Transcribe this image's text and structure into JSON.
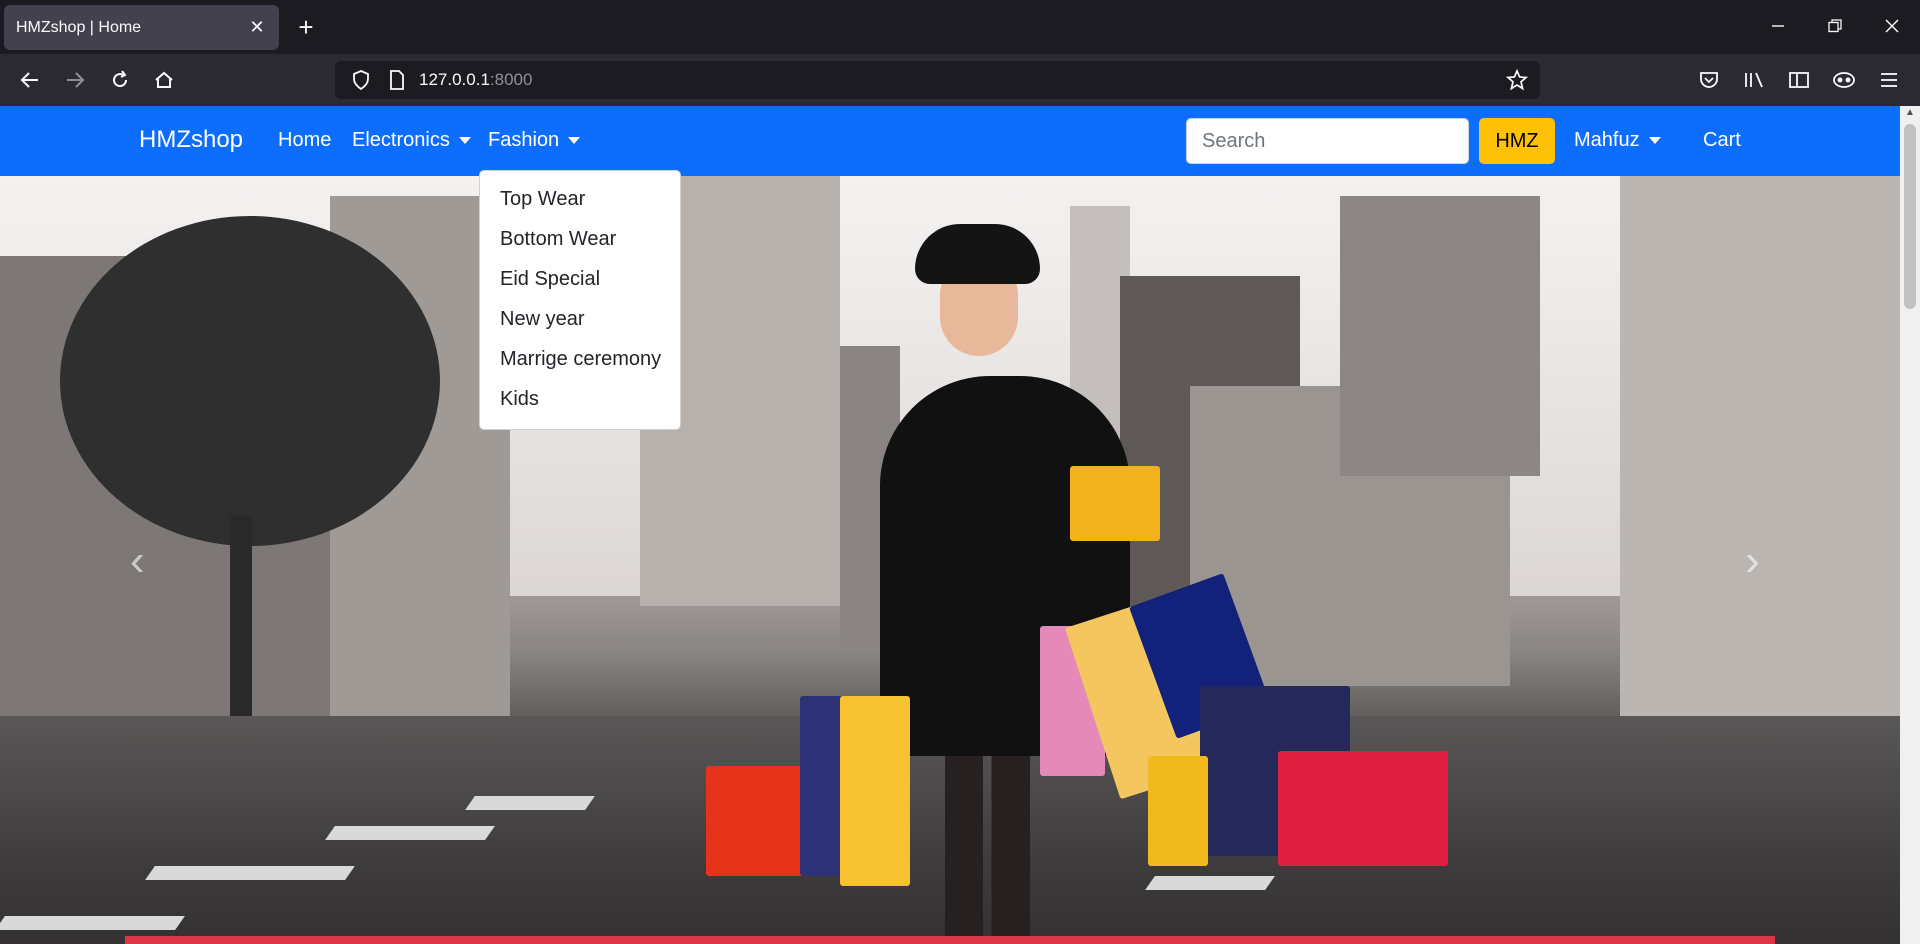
{
  "browser": {
    "tab_title": "HMZshop | Home",
    "tab_close": "✕",
    "new_tab": "+",
    "url_host": "127.0.0.1",
    "url_port": ":8000"
  },
  "site": {
    "brand": "HMZshop",
    "nav": {
      "home": "Home",
      "electronics": "Electronics",
      "fashion": "Fashion",
      "user": "Mahfuz",
      "cart": "Cart"
    },
    "search": {
      "placeholder": "Search"
    },
    "search_button": "HMZ",
    "fashion_menu": [
      "Top Wear",
      "Bottom Wear",
      "Eid Special",
      "New year",
      "Marrige ceremony",
      "Kids"
    ],
    "carousel_prev": "‹",
    "carousel_next": "›"
  },
  "colors": {
    "nav_bg": "#0d6efd",
    "search_btn": "#ffc107",
    "accent_bar": "#dc3545"
  }
}
